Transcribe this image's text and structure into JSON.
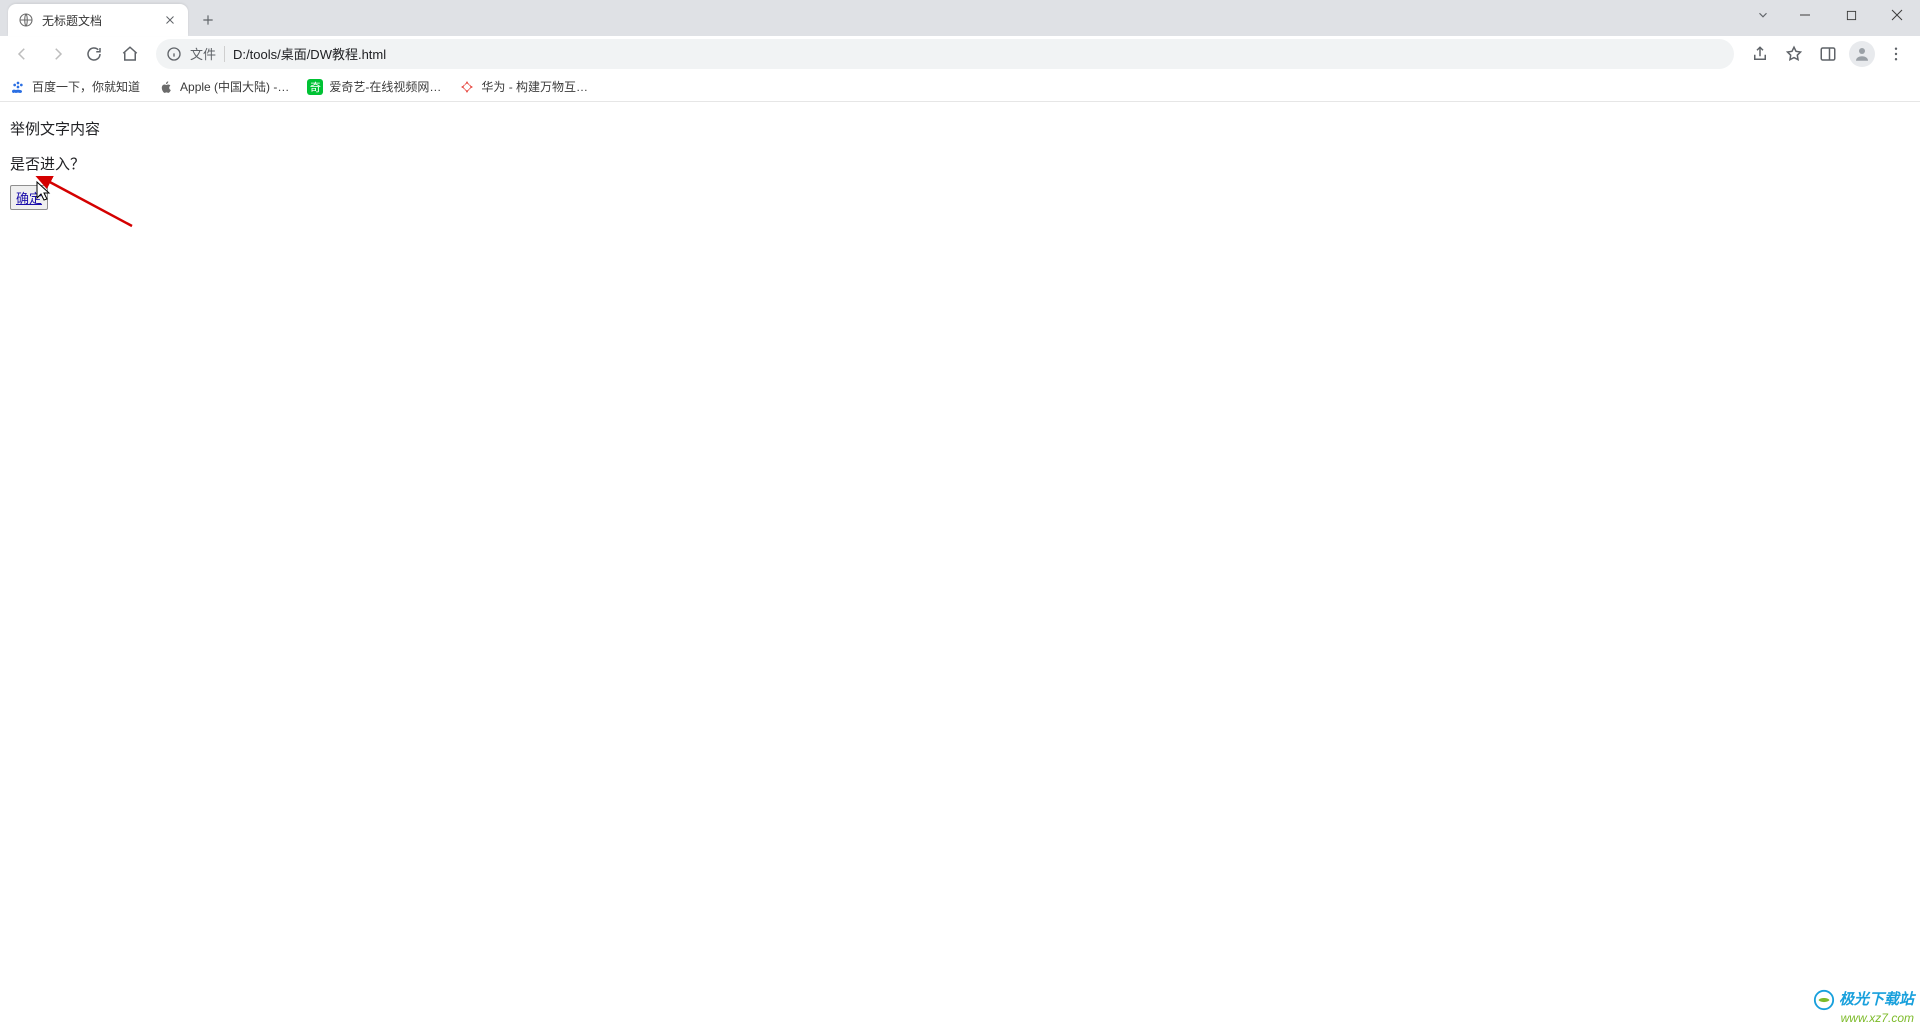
{
  "tab": {
    "title": "无标题文档"
  },
  "addressbar": {
    "scheme_label": "文件",
    "url": "D:/tools/桌面/DW教程.html"
  },
  "bookmarks": [
    {
      "label": "百度一下，你就知道",
      "kind": "baidu"
    },
    {
      "label": "Apple (中国大陆) -…",
      "kind": "apple"
    },
    {
      "label": "爱奇艺-在线视频网…",
      "kind": "iqiyi"
    },
    {
      "label": "华为 - 构建万物互…",
      "kind": "huawei"
    }
  ],
  "page": {
    "line1": "举例文字内容",
    "line2": "是否进入？",
    "button_label": "确定"
  },
  "watermark": {
    "name": "极光下载站",
    "url": "www.xz7.com"
  }
}
